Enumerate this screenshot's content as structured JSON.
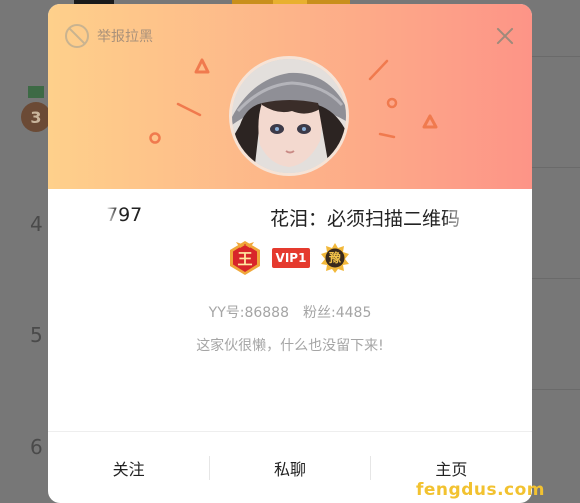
{
  "background": {
    "rank_numbers": [
      "3",
      "4",
      "5",
      "6"
    ]
  },
  "modal": {
    "report_label": "举报拉黑",
    "username_left": "797",
    "username_right": "花泪：必须扫描二维码",
    "badges": {
      "king_char": "王",
      "vip_label": "VIP1",
      "hero_char": "豫"
    },
    "yy_id": "YY号:86888",
    "fans": "粉丝:4485",
    "bio": "这家伙很懒，什么也没留下来!",
    "footer": {
      "follow_label": "关注",
      "chat_label": "私聊",
      "home_label": "主页"
    }
  },
  "watermark": "fengdus.com",
  "colors": {
    "header_left": "#fed08b",
    "header_right": "#fd9487",
    "vip_red": "#e53a2e",
    "watermark": "#f2c230"
  },
  "icons": [
    "ban-icon",
    "close-icon",
    "king-badge-icon",
    "hero-badge-icon"
  ]
}
